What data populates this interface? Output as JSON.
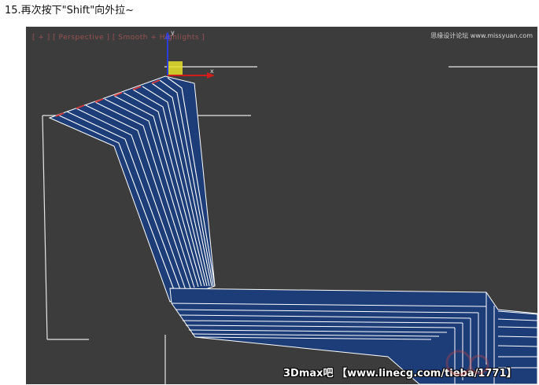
{
  "caption": "15.再次按下\"Shift\"向外拉~",
  "viewport": {
    "label": "[ + ] [ Perspective ] [ Smooth + Highlights ]",
    "watermark_top": "思缘设计论坛 www.missyuan.com",
    "watermark_bottom": "3Dmax吧 【www.linecg.com/tieba/1771】",
    "axis_x_label": "x",
    "axis_y_label": "y",
    "colors": {
      "background": "#3c3c3c",
      "mesh": "#1c3d78",
      "edge": "#ffffff",
      "selected_edge": "#d23838",
      "gizmo_x": "#d01c1c",
      "gizmo_y": "#2a3ee0",
      "gizmo_plane": "#e6e22a"
    }
  }
}
